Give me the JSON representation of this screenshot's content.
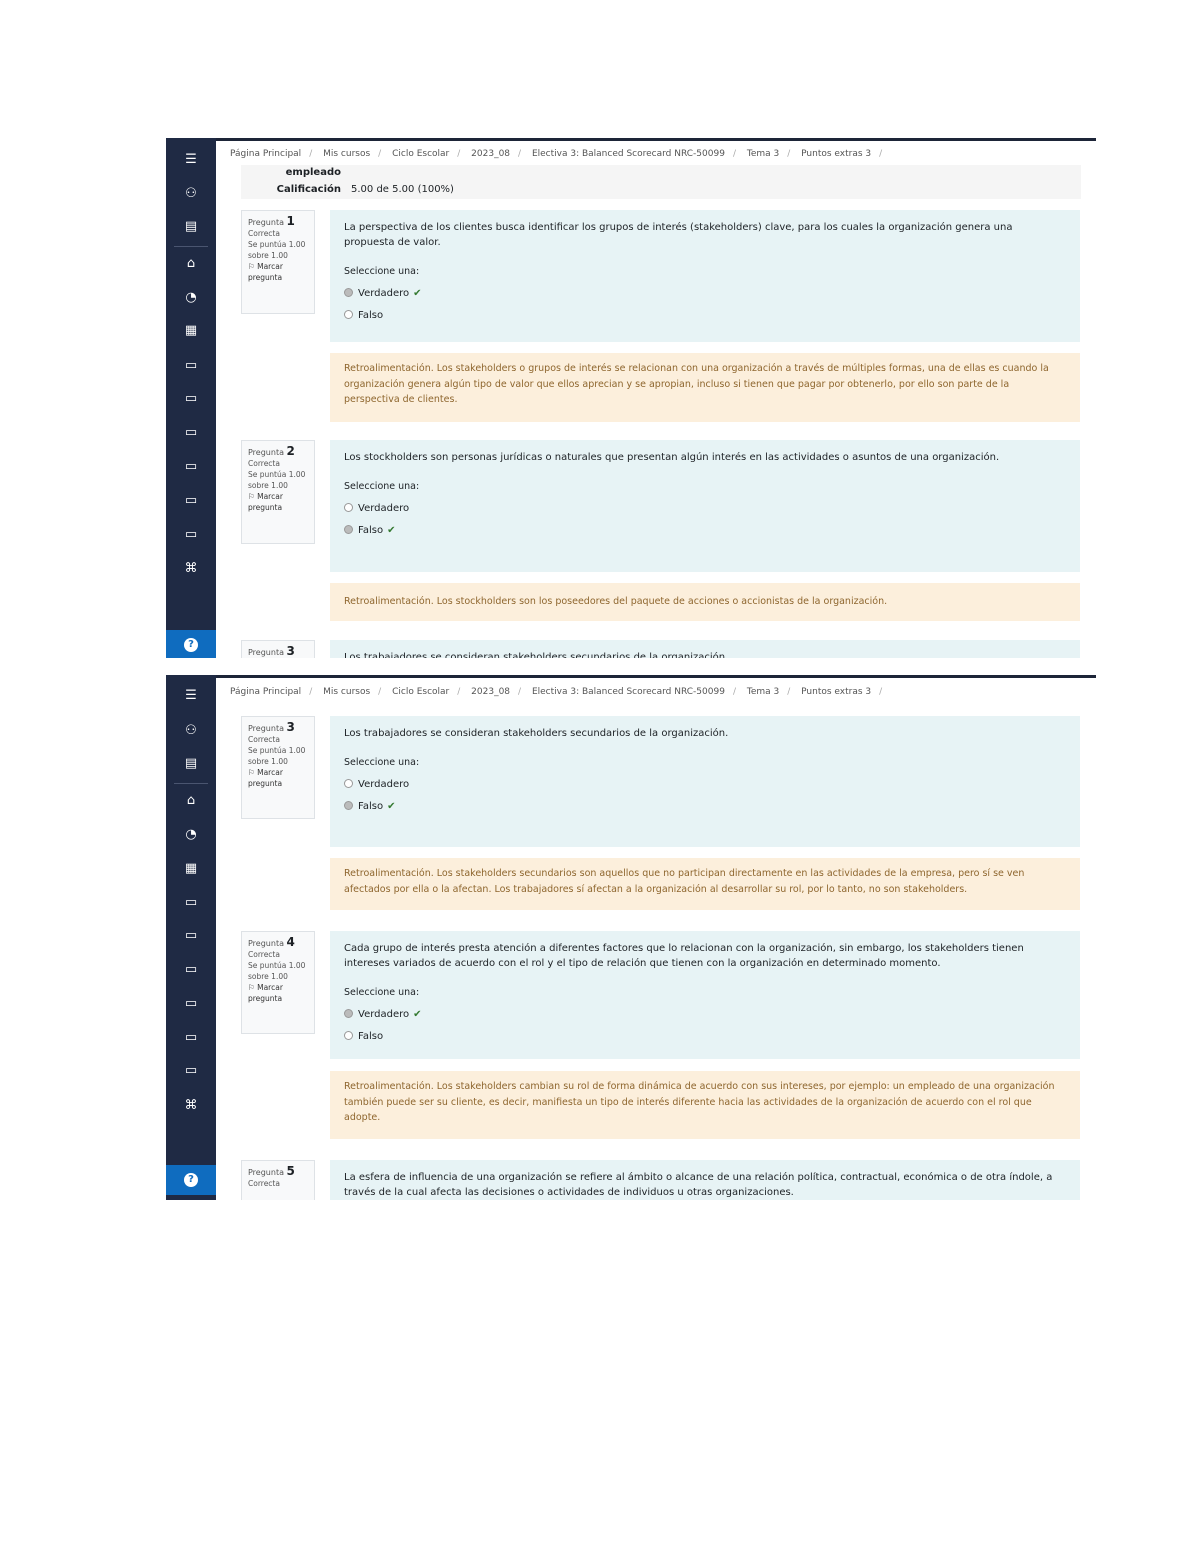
{
  "breadcrumb": {
    "top": [
      "Página Principal",
      "Mis cursos",
      "Ciclo Escolar",
      "2023_08",
      "Electiva 3: Balanced Scorecard NRC-50099",
      "Tema 3",
      "Puntos extras 3"
    ],
    "bottom": [
      "Página Principal",
      "Mis cursos",
      "Ciclo Escolar",
      "2023_08",
      "Electiva 3: Balanced Scorecard NRC-50099",
      "Tema 3",
      "Puntos extras 3"
    ]
  },
  "summary": {
    "time_label": "empleado",
    "grade_label": "Calificación",
    "grade_value": "5.00 de 5.00 (100%)"
  },
  "sidebar_icons": [
    "menu-icon",
    "users-icon",
    "book-icon",
    "home-icon",
    "dashboard-icon",
    "calendar-icon",
    "folder-icon",
    "folder-icon",
    "folder-icon",
    "folder-icon",
    "folder-icon",
    "folder-icon",
    "graduation-icon",
    "help-icon"
  ],
  "select_prompt": "Seleccione una:",
  "options": {
    "true": "Verdadero",
    "false": "Falso"
  },
  "questions": [
    {
      "label": "Pregunta",
      "number": "1",
      "status": "Correcta",
      "score": "Se puntúa 1.00 sobre 1.00",
      "flag": "Marcar pregunta",
      "text": "La perspectiva de los clientes busca identificar los grupos de interés (stakeholders) clave, para los cuales la organización genera una propuesta de valor.",
      "selected": "Verdadero",
      "feedback": "Retroalimentación. Los stakeholders o grupos de interés se relacionan con una organización a través de múltiples formas, una de ellas es cuando la organización genera algún tipo de valor que ellos aprecian y se apropian, incluso si tienen que pagar por obtenerlo, por ello son parte de la perspectiva de clientes."
    },
    {
      "label": "Pregunta",
      "number": "2",
      "status": "Correcta",
      "score": "Se puntúa 1.00 sobre 1.00",
      "flag": "Marcar pregunta",
      "text": "Los stockholders son personas jurídicas o naturales que presentan algún interés en las actividades o asuntos de una organización.",
      "selected": "Falso",
      "feedback": "Retroalimentación. Los stockholders son los poseedores del paquete de acciones o accionistas de la organización."
    },
    {
      "label": "Pregunta",
      "number": "3",
      "status": "Correcta",
      "score": "Se puntúa 1.00 sobre 1.00",
      "flag": "Marcar pregunta",
      "text": "Los trabajadores se consideran stakeholders secundarios de la organización.",
      "selected": "Falso",
      "feedback": "Retroalimentación. Los stakeholders secundarios son aquellos que no participan directamente en las actividades de la empresa, pero sí se ven afectados por ella o la afectan. Los trabajadores sí afectan a la organización al desarrollar su rol, por lo tanto, no son stakeholders."
    },
    {
      "label": "Pregunta",
      "number": "4",
      "status": "Correcta",
      "score": "Se puntúa 1.00 sobre 1.00",
      "flag": "Marcar pregunta",
      "text": "Cada grupo de interés presta atención a diferentes factores que lo relacionan con la organización, sin embargo, los stakeholders tienen intereses variados de acuerdo con el rol y el tipo de relación que tienen con la organización en determinado momento.",
      "selected": "Verdadero",
      "feedback": "Retroalimentación. Los stakeholders cambian su rol de forma dinámica de acuerdo con sus intereses, por ejemplo: un empleado de una organización también puede ser su cliente, es decir, manifiesta un tipo de interés diferente hacia las actividades de la organización de acuerdo con el rol que adopte."
    },
    {
      "label": "Pregunta",
      "number": "5",
      "status": "Correcta",
      "text": "La esfera de influencia de una organización se refiere al ámbito o alcance de una relación política, contractual, económica o de otra índole, a través de la cual afecta las decisiones o actividades de individuos u otras organizaciones."
    }
  ]
}
